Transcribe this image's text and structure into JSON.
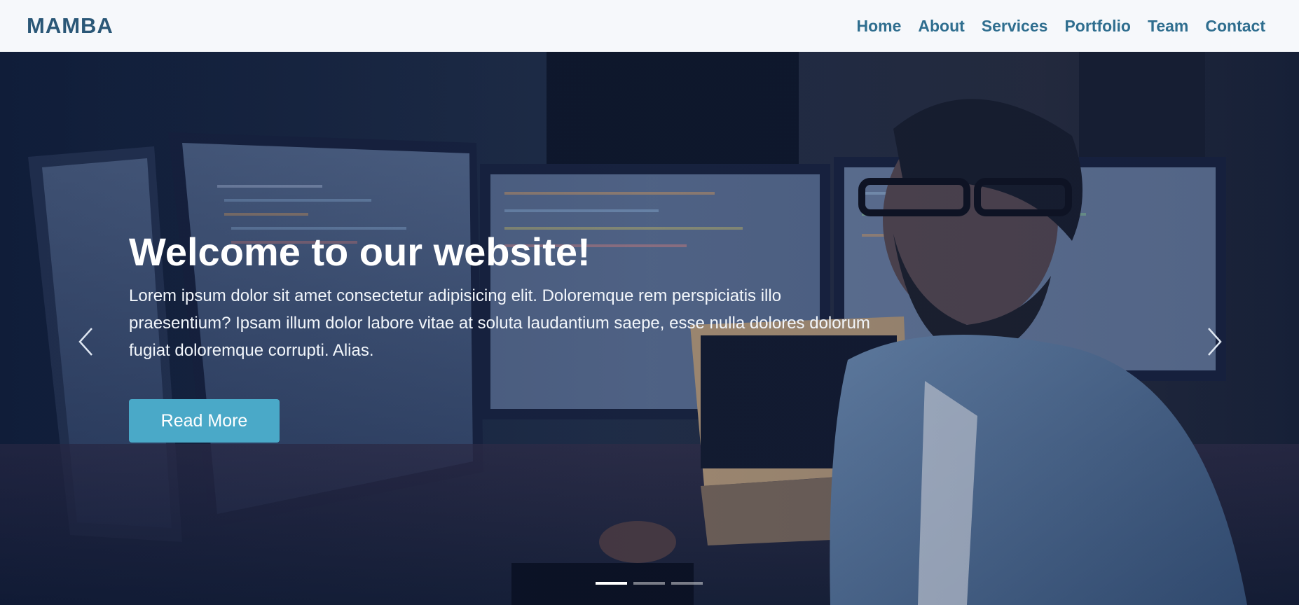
{
  "header": {
    "logo": "MAMBA",
    "nav": [
      "Home",
      "About",
      "Services",
      "Portfolio",
      "Team",
      "Contact"
    ]
  },
  "hero": {
    "title": "Welcome to our website!",
    "text": "Lorem ipsum dolor sit amet consectetur adipisicing elit. Doloremque rem perspiciatis illo praesentium? Ipsam illum dolor labore vitae at soluta laudantium saepe, esse nulla dolores dolorum fugiat doloremque corrupti. Alias.",
    "button_label": "Read More",
    "indicators": {
      "count": 3,
      "active": 0
    }
  },
  "icons": {
    "prev": "chevron-left-icon",
    "next": "chevron-right-icon"
  },
  "colors": {
    "header_bg": "#f6f8fb",
    "logo": "#2a5777",
    "nav_link": "#2f6e8f",
    "button": "#4aa9c8"
  }
}
